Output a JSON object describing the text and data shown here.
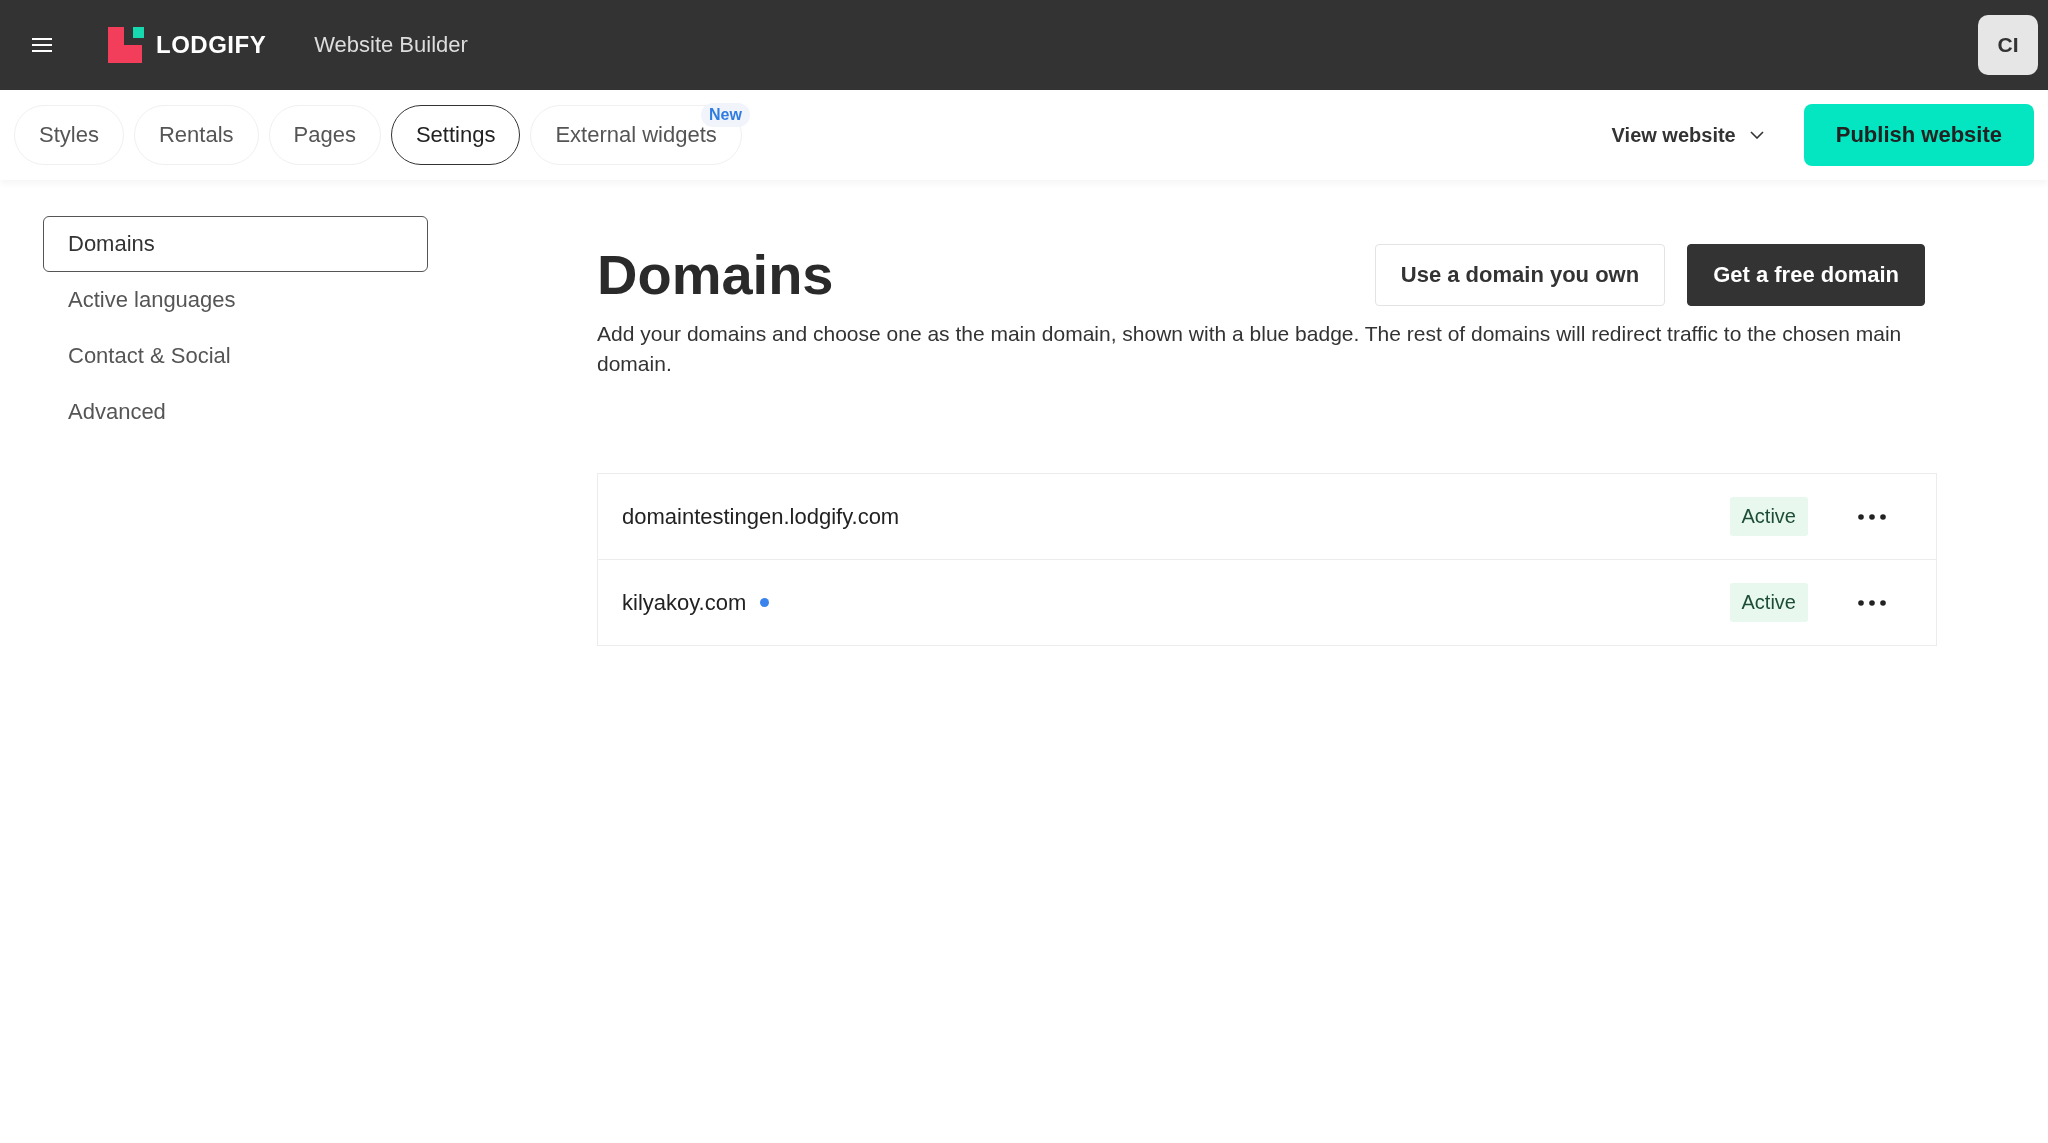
{
  "header": {
    "logo_text": "LODGIFY",
    "app_title": "Website Builder",
    "avatar": "CI"
  },
  "tabs": [
    {
      "label": "Styles",
      "selected": false
    },
    {
      "label": "Rentals",
      "selected": false
    },
    {
      "label": "Pages",
      "selected": false
    },
    {
      "label": "Settings",
      "selected": true
    },
    {
      "label": "External widgets",
      "selected": false,
      "badge": "New"
    }
  ],
  "view_website": "View website",
  "publish_button": "Publish website",
  "sidebar": {
    "items": [
      {
        "label": "Domains",
        "selected": true
      },
      {
        "label": "Active languages",
        "selected": false
      },
      {
        "label": "Contact & Social",
        "selected": false
      },
      {
        "label": "Advanced",
        "selected": false
      }
    ]
  },
  "page": {
    "title": "Domains",
    "buttons": [
      "Use a domain you own",
      "Get a free domain"
    ],
    "description": "Add your domains and choose one as the main domain, shown with a blue badge. The rest of domains will redirect traffic to the chosen main domain."
  },
  "domains": [
    {
      "name": "domaintestingen.lodgify.com",
      "main": false,
      "status": "Active"
    },
    {
      "name": "kilyakoy.com",
      "main": true,
      "status": "Active"
    }
  ]
}
